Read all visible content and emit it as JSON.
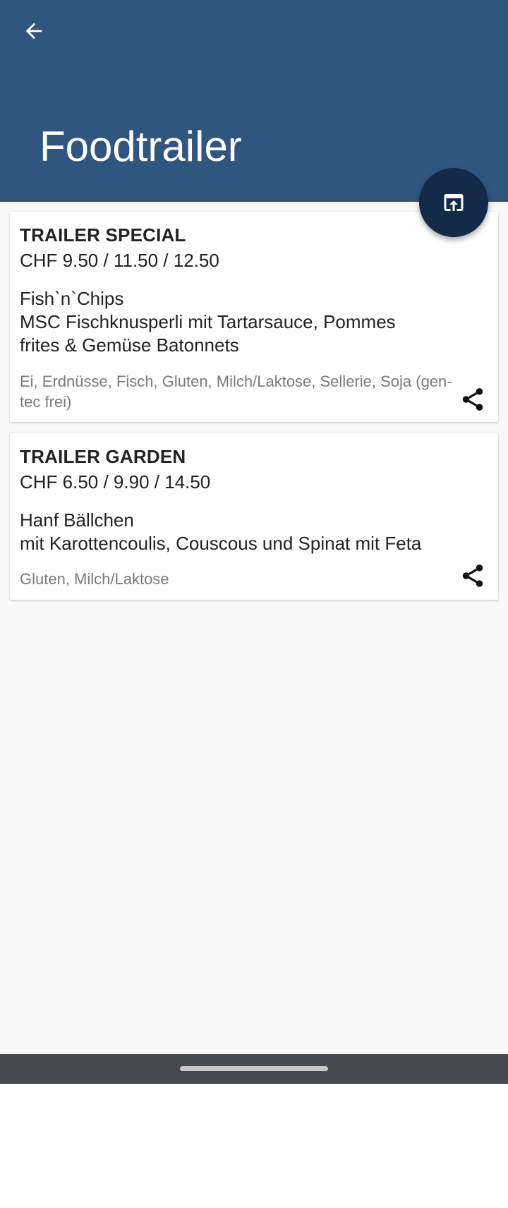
{
  "header": {
    "title": "Foodtrailer",
    "back_icon": "arrow-back-icon",
    "fab_icon": "open-in-browser-icon",
    "background": "#30557f",
    "fab_color": "#132a48"
  },
  "menu": [
    {
      "title": "TRAILER SPECIAL",
      "price": "CHF 9.50 / 11.50 / 12.50",
      "description": [
        "Fish`n`Chips",
        "MSC Fischknusperli mit Tartarsauce, Pommes",
        "frites & Gemüse Batonnets"
      ],
      "allergens": "Ei, Erdnüsse, Fisch, Gluten, Milch/Laktose, Sellerie, Soja (gen-tec frei)"
    },
    {
      "title": "TRAILER GARDEN",
      "price": "CHF 6.50 / 9.90 / 14.50",
      "description": [
        "Hanf Bällchen",
        "mit Karottencoulis, Couscous und Spinat mit Feta"
      ],
      "allergens": "Gluten, Milch/Laktose"
    }
  ],
  "share_icon": "share-icon"
}
